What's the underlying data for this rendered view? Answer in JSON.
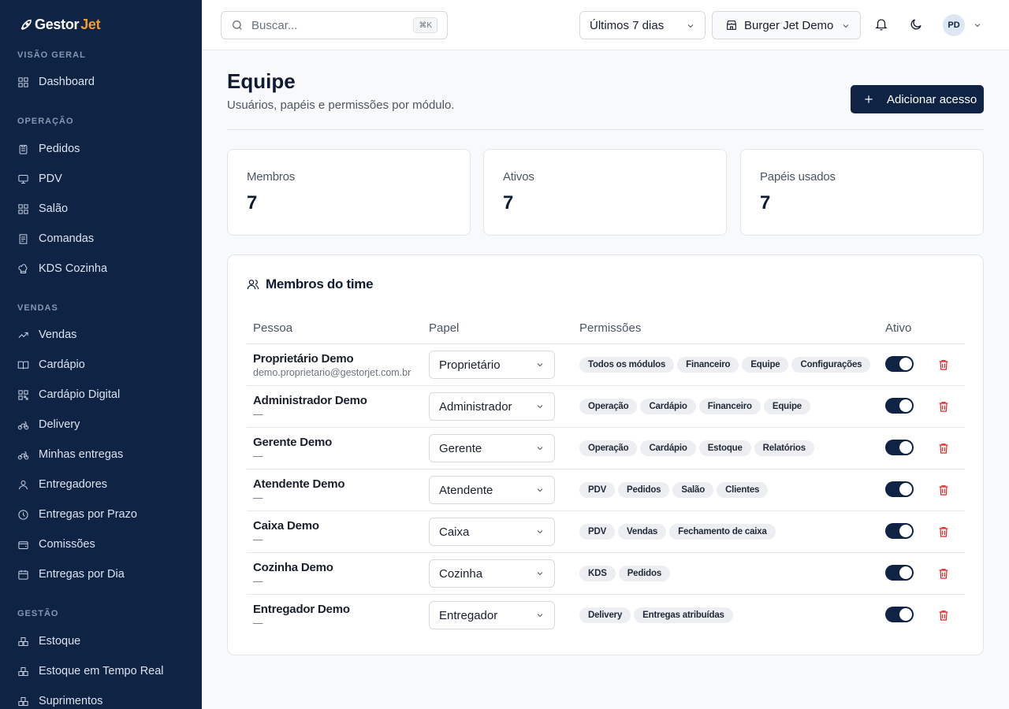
{
  "brand": {
    "part1": "Gestor",
    "part2": "Jet"
  },
  "sidebar": {
    "sections": [
      {
        "label": "VISÃO GERAL"
      },
      {
        "label": "OPERAÇÃO"
      },
      {
        "label": "VENDAS"
      },
      {
        "label": "GESTÃO"
      }
    ],
    "items": [
      {
        "label": "Dashboard"
      },
      {
        "label": "Pedidos"
      },
      {
        "label": "PDV"
      },
      {
        "label": "Salão"
      },
      {
        "label": "Comandas"
      },
      {
        "label": "KDS Cozinha"
      },
      {
        "label": "Vendas"
      },
      {
        "label": "Cardápio"
      },
      {
        "label": "Cardápio Digital"
      },
      {
        "label": "Delivery"
      },
      {
        "label": "Minhas entregas"
      },
      {
        "label": "Entregadores"
      },
      {
        "label": "Entregas por Prazo"
      },
      {
        "label": "Comissões"
      },
      {
        "label": "Entregas por Dia"
      },
      {
        "label": "Estoque"
      },
      {
        "label": "Estoque em Tempo Real"
      },
      {
        "label": "Suprimentos"
      }
    ]
  },
  "topbar": {
    "search_placeholder": "Buscar...",
    "search_shortcut": "⌘K",
    "period": "Últimos 7 dias",
    "store": "Burger Jet Demo",
    "avatar_initials": "PD"
  },
  "page": {
    "title": "Equipe",
    "subtitle": "Usuários, papéis e permissões por módulo.",
    "add_button": "Adicionar acesso"
  },
  "stats": [
    {
      "label": "Membros",
      "value": "7"
    },
    {
      "label": "Ativos",
      "value": "7"
    },
    {
      "label": "Papéis usados",
      "value": "7"
    }
  ],
  "team": {
    "title": "Membros do time",
    "headers": {
      "person": "Pessoa",
      "role": "Papel",
      "permissions": "Permissões",
      "active": "Ativo"
    },
    "members": [
      {
        "name": "Proprietário Demo",
        "email": "demo.proprietario@gestorjet.com.br",
        "role": "Proprietário",
        "permissions": [
          "Todos os módulos",
          "Financeiro",
          "Equipe",
          "Configurações"
        ],
        "active": true
      },
      {
        "name": "Administrador Demo",
        "email": "—",
        "role": "Administrador",
        "permissions": [
          "Operação",
          "Cardápio",
          "Financeiro",
          "Equipe"
        ],
        "active": true
      },
      {
        "name": "Gerente Demo",
        "email": "—",
        "role": "Gerente",
        "permissions": [
          "Operação",
          "Cardápio",
          "Estoque",
          "Relatórios"
        ],
        "active": true
      },
      {
        "name": "Atendente Demo",
        "email": "—",
        "role": "Atendente",
        "permissions": [
          "PDV",
          "Pedidos",
          "Salão",
          "Clientes"
        ],
        "active": true
      },
      {
        "name": "Caixa Demo",
        "email": "—",
        "role": "Caixa",
        "permissions": [
          "PDV",
          "Vendas",
          "Fechamento de caixa"
        ],
        "active": true
      },
      {
        "name": "Cozinha Demo",
        "email": "—",
        "role": "Cozinha",
        "permissions": [
          "KDS",
          "Pedidos"
        ],
        "active": true
      },
      {
        "name": "Entregador Demo",
        "email": "—",
        "role": "Entregador",
        "permissions": [
          "Delivery",
          "Entregas atribuídas"
        ],
        "active": true
      }
    ]
  },
  "colors": {
    "sidebar_bg": "#0f2345",
    "accent": "#0f2345",
    "brand_orange": "#f49b2a",
    "danger": "#dc2626"
  }
}
